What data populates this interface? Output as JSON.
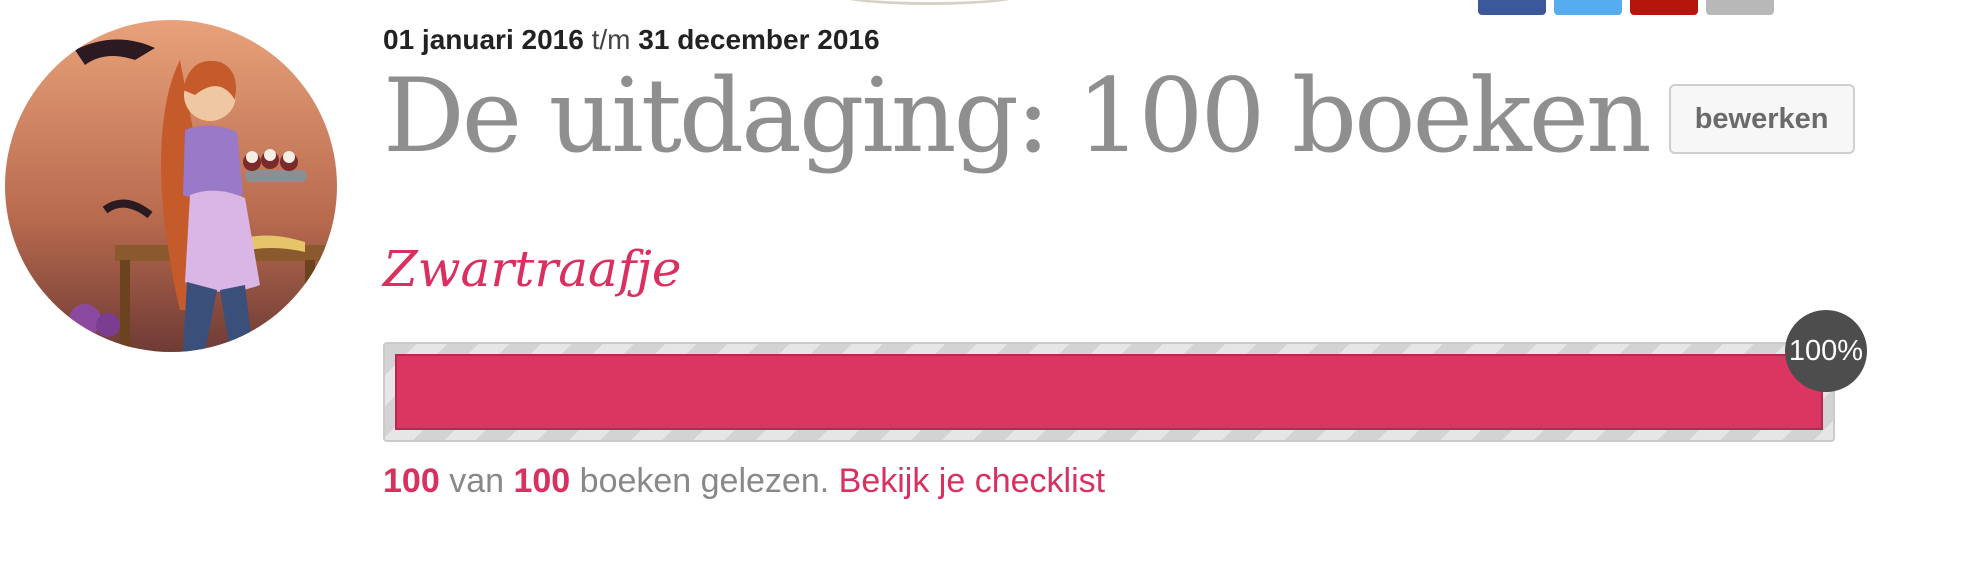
{
  "share": {
    "buttons": [
      {
        "name": "facebook",
        "color": "#3b5998"
      },
      {
        "name": "twitter",
        "color": "#55acee"
      },
      {
        "name": "pinterest",
        "color": "#b5150b"
      },
      {
        "name": "email",
        "color": "#b8b8b8"
      }
    ]
  },
  "avatar": {
    "icon": "user-avatar-illustration"
  },
  "period": {
    "start": "01 januari 2016",
    "separator": "t/m",
    "end": "31 december 2016"
  },
  "challenge": {
    "title": "De uitdaging: 100 boeken",
    "edit_label": "bewerken",
    "user_name": "Zwartraafje",
    "progress_percent": 100,
    "progress_label": "100%",
    "read_count": "100",
    "of_text": "van",
    "goal_count": "100",
    "read_text": "boeken gelezen.",
    "checklist_link": "Bekijk je checklist"
  },
  "colors": {
    "accent": "#d9305f",
    "bar": "#db3661",
    "badge": "#4d4d4d",
    "title": "#8f8f8f"
  }
}
